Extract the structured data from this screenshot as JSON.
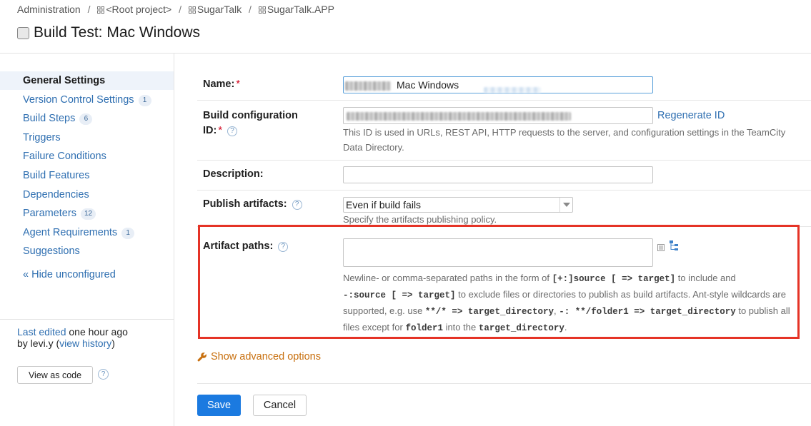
{
  "breadcrumb": {
    "items": [
      "Administration",
      "<Root project>",
      "SugarTalk",
      "SugarTalk.APP"
    ],
    "separator": "/"
  },
  "page": {
    "title": "Build Test: Mac Windows"
  },
  "sidebar": {
    "items": [
      {
        "label": "General Settings",
        "badge": ""
      },
      {
        "label": "Version Control Settings",
        "badge": "1"
      },
      {
        "label": "Build Steps",
        "badge": "6"
      },
      {
        "label": "Triggers",
        "badge": ""
      },
      {
        "label": "Failure Conditions",
        "badge": ""
      },
      {
        "label": "Build Features",
        "badge": ""
      },
      {
        "label": "Dependencies",
        "badge": ""
      },
      {
        "label": "Parameters",
        "badge": "12"
      },
      {
        "label": "Agent Requirements",
        "badge": "1"
      },
      {
        "label": "Suggestions",
        "badge": ""
      }
    ],
    "hide_unconfigured": "« Hide unconfigured",
    "last_edited_link": "Last edited",
    "last_edited_time": " one hour ago",
    "last_edited_by": "by levi.y  (",
    "view_history": "view history",
    "close_paren": ")",
    "view_as_code": "View as code"
  },
  "form": {
    "name": {
      "label": "Name:",
      "required": "*",
      "value": "Mac Windows"
    },
    "build_config_id": {
      "label_line1": "Build configuration",
      "label_line2": "ID:",
      "required": "*",
      "regenerate": "Regenerate ID",
      "hint": "This ID is used in URLs, REST API, HTTP requests to the server, and configuration settings in the TeamCity Data Directory."
    },
    "description": {
      "label": "Description:",
      "value": ""
    },
    "publish_artifacts": {
      "label": "Publish artifacts:",
      "selected": "Even if build fails",
      "hint": "Specify the artifacts publishing policy."
    },
    "artifact_paths": {
      "label": "Artifact paths:",
      "value": "",
      "hint_1": "Newline- or comma-separated paths in the form of ",
      "code_1": "[+:]source [ => target]",
      "hint_2": " to include and",
      "code_2": "-:source [ => target]",
      "hint_3": " to exclude files or directories to publish as build artifacts. Ant-style wildcards are",
      "hint_4": "supported, e.g. use ",
      "code_3": "**/* => target_directory",
      "hint_5": ", ",
      "code_4": "-: **/folder1 => target_directory",
      "hint_6": " to publish all",
      "hint_7": "files except for ",
      "code_5": "folder1",
      "hint_8": " into the ",
      "code_6": "target_directory",
      "hint_9": "."
    },
    "show_advanced": "Show advanced options"
  },
  "actions": {
    "save": "Save",
    "cancel": "Cancel"
  },
  "colors": {
    "link": "#2f6fb1",
    "primary_button": "#1b7ae0",
    "highlight": "#e53326",
    "advanced": "#c8700f",
    "required": "#d0021b"
  },
  "icons": [
    "project-icon",
    "checkbox-icon",
    "help-icon",
    "dropdown-arrow-icon",
    "text-editor-icon",
    "tree-picker-icon",
    "wrench-icon"
  ]
}
